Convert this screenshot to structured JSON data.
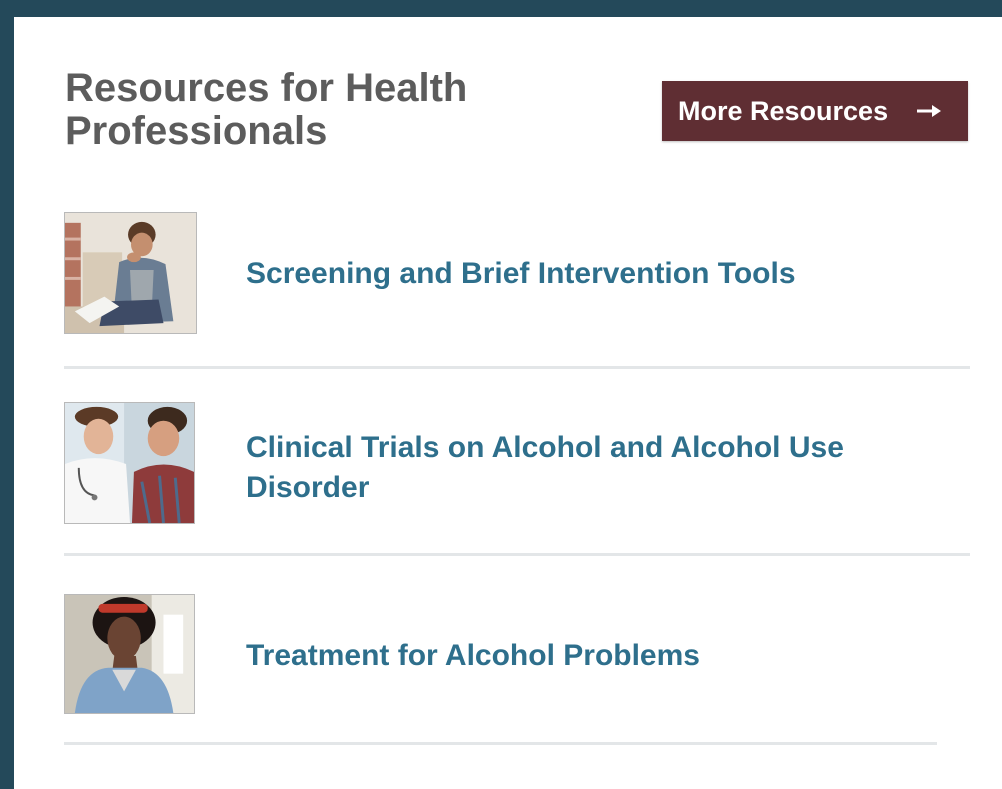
{
  "header": {
    "title": "Resources for Health Professionals",
    "button_label": "More Resources",
    "button_icon": "arrow-right-icon"
  },
  "colors": {
    "frame": "#24495a",
    "button_bg": "#5f2e33",
    "link": "#2e6f8c",
    "title": "#5c5c5c"
  },
  "resources": [
    {
      "label": "Screening and Brief Intervention Tools"
    },
    {
      "label": "Clinical Trials on Alcohol and Alcohol Use Disorder"
    },
    {
      "label": "Treatment for Alcohol Problems"
    }
  ]
}
